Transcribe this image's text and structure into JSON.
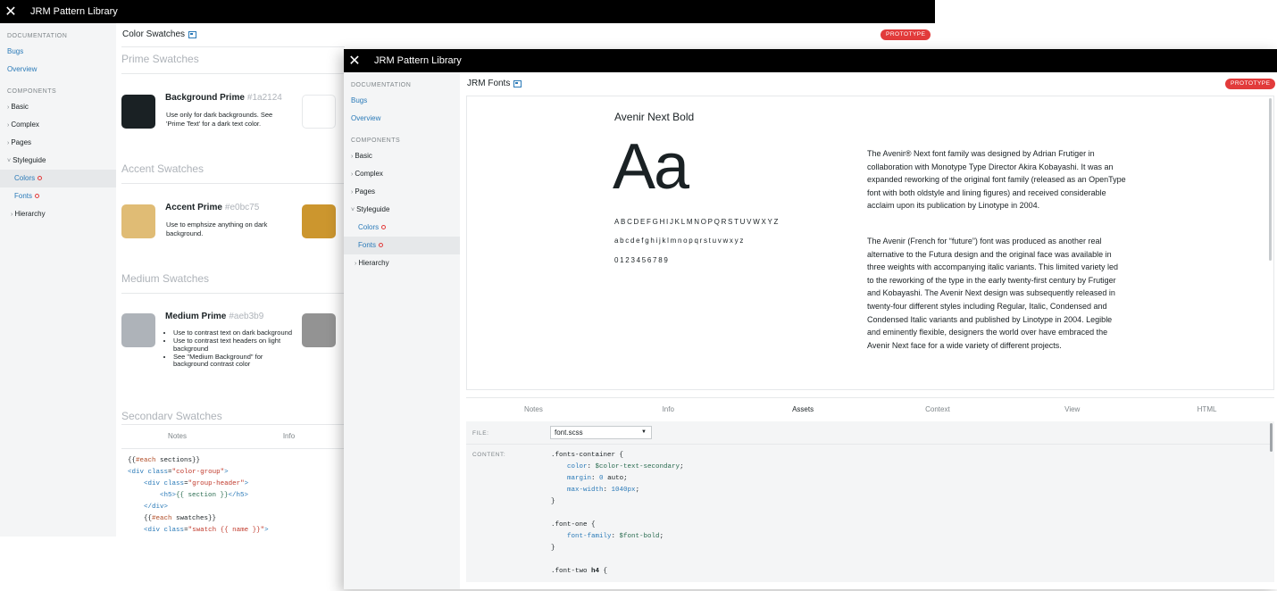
{
  "back": {
    "title": "JRM Pattern Library",
    "sidebar": {
      "doc_heading": "DOCUMENTATION",
      "links": [
        "Bugs",
        "Overview"
      ],
      "comp_heading": "COMPONENTS",
      "items": [
        "Basic",
        "Complex",
        "Pages",
        "Styleguide"
      ],
      "subs": [
        "Colors",
        "Fonts"
      ],
      "hierarchy": "Hierarchy"
    },
    "page_title": "Color Swatches",
    "badge": "PROTOTYPE",
    "sections": [
      "Prime Swatches",
      "Accent Swatches",
      "Medium Swatches",
      "Secondary Swatches"
    ],
    "swatches": [
      {
        "name": "Background Prime",
        "hex": "#1a2124",
        "color": "#1a2124",
        "desc": "Use only for dark backgrounds. See 'Prime Text' for a dark text color."
      },
      {
        "name": "Accent Prime",
        "hex": "#e0bc75",
        "color": "#e0bc75",
        "desc": "Use to emphsize anything on dark background."
      },
      {
        "name": "Medium Prime",
        "hex": "#aeb3b9",
        "color": "#aeb3b9",
        "bullets": [
          "Use to contrast text on dark background",
          "Use to contrast text headers on light background",
          "See \"Medium Background\" for background contrast color"
        ]
      }
    ],
    "side_swatch_colors": [
      "#ffffff",
      "#cc962e",
      "#939393"
    ],
    "tabs": [
      "Notes",
      "Info"
    ]
  },
  "front": {
    "title": "JRM Pattern Library",
    "sidebar": {
      "doc_heading": "DOCUMENTATION",
      "links": [
        "Bugs",
        "Overview"
      ],
      "comp_heading": "COMPONENTS",
      "items": [
        "Basic",
        "Complex",
        "Pages",
        "Styleguide"
      ],
      "subs": [
        "Colors",
        "Fonts"
      ],
      "hierarchy": "Hierarchy"
    },
    "page_title": "JRM Fonts",
    "badge": "PROTOTYPE",
    "font": {
      "name": "Avenir Next Bold",
      "sample": "Aa",
      "upper": "ABCDEFGHIJKLMNOPQRSTUVWXYZ",
      "lower": "abcdefghijklmnopqrstuvwxyz",
      "digits": "0123456789",
      "para1": "The Avenir® Next font family was designed by Adrian Frutiger in collaboration with Monotype Type Director Akira Kobayashi. It was an expanded reworking of the original font family (released as an OpenType font with both oldstyle and lining figures) and received considerable acclaim upon its publication by Linotype in 2004.",
      "para2": "The Avenir (French for “future”) font was produced as another real alternative to the Futura design and the original face was available in three weights with accompanying italic variants. This limited variety led to the reworking of the type in the early twenty-first century by Frutiger and Kobayashi. The Avenir Next design was subsequently released in twenty-four different styles including Regular, Italic, Condensed and Condensed Italic variants and published by Linotype in 2004. Legible and eminently flexible, designers the world over have embraced the Avenir Next face for a wide variety of different projects."
    },
    "tabs": [
      "Notes",
      "Info",
      "Assets",
      "Context",
      "View",
      "HTML"
    ],
    "active_tab": "Assets",
    "assets": {
      "file_label": "FILE:",
      "file_value": "font.scss",
      "content_label": "CONTENT:"
    }
  },
  "colors": {
    "accent": "#2a7ab8",
    "badge": "#e23b3b",
    "titlebar": "#000000"
  }
}
